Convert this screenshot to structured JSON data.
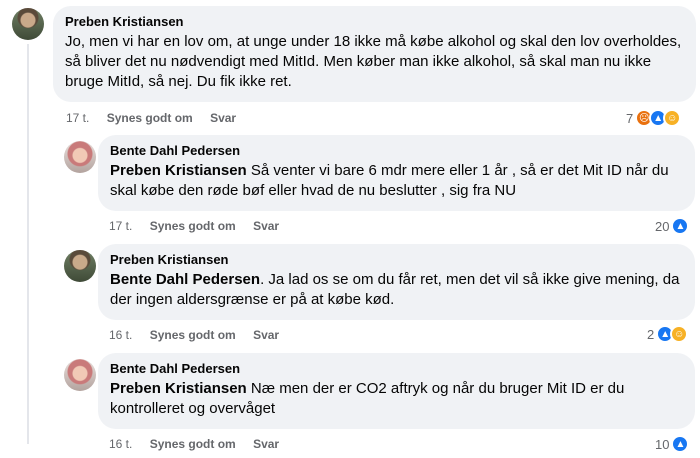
{
  "comments": [
    {
      "author": "Preben Kristiansen",
      "mention": "",
      "text": "Jo, men vi har en lov om, at unge under 18 ikke må købe alkohol og skal den lov overholdes, så bliver det nu nødvendigt med MitId. Men køber man ikke alkohol, så skal man nu ikke bruge MitId, så nej. Du fik ikke ret.",
      "time": "17 t.",
      "like_label": "Synes godt om",
      "reply_label": "Svar",
      "reaction_count": "7",
      "reactions": [
        "angry-icon",
        "like-icon",
        "haha-icon"
      ]
    },
    {
      "author": "Bente Dahl Pedersen",
      "mention": "Preben Kristiansen",
      "text": " Så venter vi bare 6 mdr mere eller 1 år , så er det Mit ID når du skal købe den røde bøf eller hvad de nu beslutter , sig fra NU",
      "time": "17 t.",
      "like_label": "Synes godt om",
      "reply_label": "Svar",
      "reaction_count": "20",
      "reactions": [
        "like-icon"
      ]
    },
    {
      "author": "Preben Kristiansen",
      "mention": "Bente Dahl Pedersen",
      "text": ". Ja lad os se om du får ret, men det vil så ikke give mening, da der ingen aldersgrænse er på at købe kød.",
      "time": "16 t.",
      "like_label": "Synes godt om",
      "reply_label": "Svar",
      "reaction_count": "2",
      "reactions": [
        "like-icon",
        "haha-icon"
      ]
    },
    {
      "author": "Bente Dahl Pedersen",
      "mention": "Preben Kristiansen",
      "text": " Næ men der er CO2 aftryk og når du bruger Mit ID er du kontrolleret og overvåget",
      "time": "16 t.",
      "like_label": "Synes godt om",
      "reply_label": "Svar",
      "reaction_count": "10",
      "reactions": [
        "like-icon"
      ]
    }
  ],
  "colors": {
    "bubble": "#f0f2f5",
    "like": "#1877f2",
    "angry": "#e9710f",
    "haha": "#f7b125",
    "meta_text": "#65676b"
  }
}
